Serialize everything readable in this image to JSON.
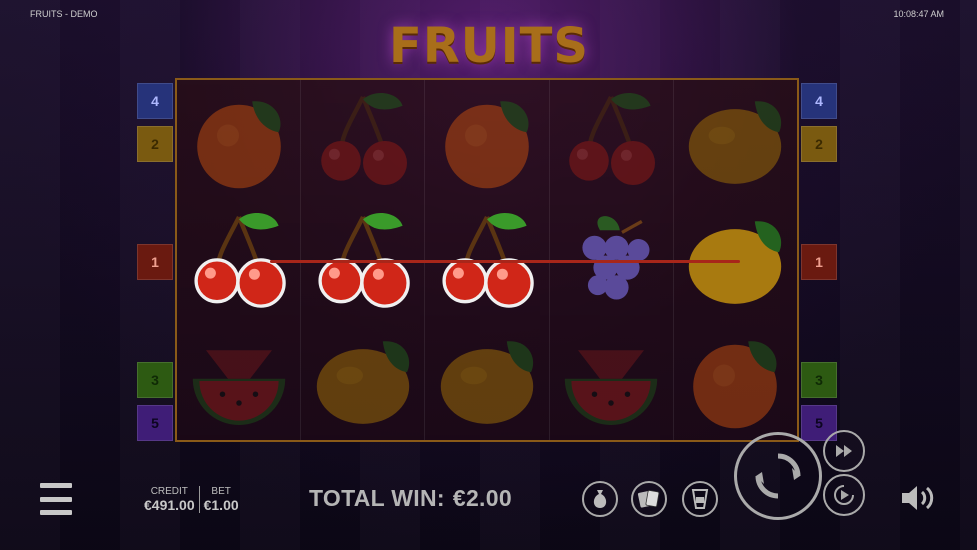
{
  "header": {
    "game_name": "FRUITS - DEMO",
    "clock": "10:08:47 AM"
  },
  "logo": {
    "text": "FRUITS"
  },
  "reels": [
    [
      "orange",
      "cherry",
      "watermelon"
    ],
    [
      "cherry",
      "cherry",
      "lemon"
    ],
    [
      "orange",
      "cherry",
      "lemon"
    ],
    [
      "cherry",
      "grapes",
      "watermelon"
    ],
    [
      "lemon",
      "lemon",
      "orange"
    ]
  ],
  "paylines": {
    "left": [
      "4",
      "2",
      "1",
      "3",
      "5"
    ],
    "right": [
      "4",
      "2",
      "1",
      "3",
      "5"
    ]
  },
  "winning_line": "1",
  "footer": {
    "credit_label": "CREDIT",
    "credit_value": "€491.00",
    "bet_label": "BET",
    "bet_value": "€1.00",
    "total_win_label": "TOTAL WIN:",
    "total_win_value": "€2.00"
  },
  "icons": {
    "menu": "hamburger-icon",
    "bag": "money-bag-icon",
    "cards": "cards-icon",
    "gamble": "gamble-icon",
    "spin": "spin-icon",
    "fast_forward": "fast-forward-icon",
    "autoplay": "autoplay-icon",
    "volume": "speaker-icon"
  },
  "colors": {
    "payline": "#a8261a",
    "frame": "#8a5a18"
  }
}
